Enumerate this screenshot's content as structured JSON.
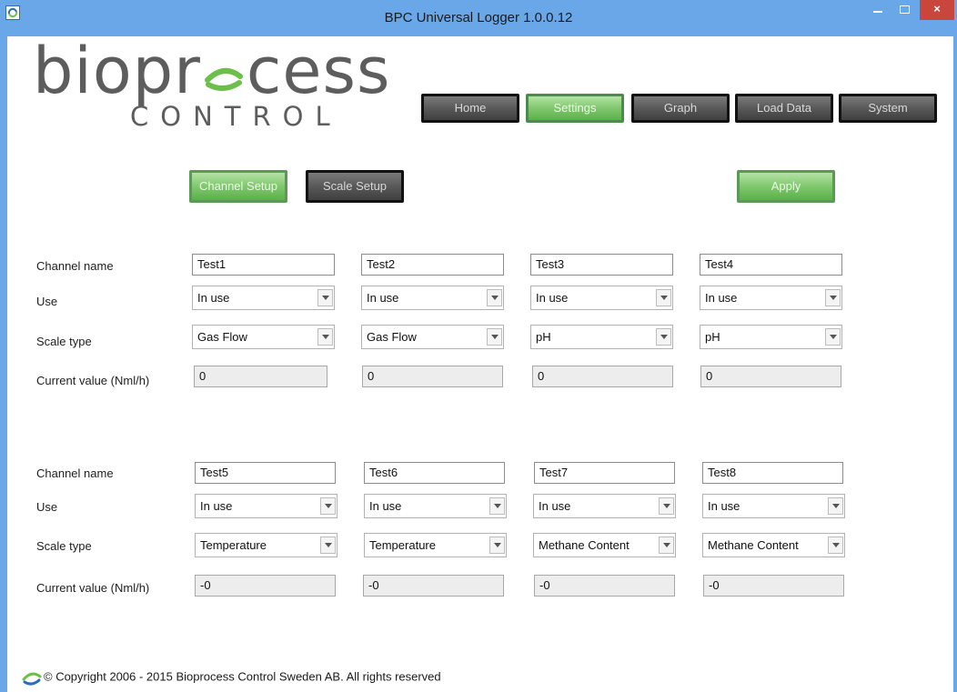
{
  "window": {
    "title": "BPC Universal Logger 1.0.0.12",
    "close_glyph": "×"
  },
  "logo": {
    "main": "bioprocess",
    "main_before": "biopr",
    "main_after": "cess",
    "sub": "CONTROL"
  },
  "nav": {
    "home": "Home",
    "settings": "Settings",
    "graph": "Graph",
    "load_data": "Load Data",
    "system": "System",
    "active": "Settings"
  },
  "subnav": {
    "channel_setup": "Channel Setup",
    "scale_setup": "Scale Setup",
    "apply": "Apply",
    "active": "Channel Setup"
  },
  "labels": {
    "channel_name": "Channel name",
    "use": "Use",
    "scale_type": "Scale type",
    "current_value": "Current value (Nml/h)"
  },
  "groups": [
    {
      "channels": [
        {
          "name": "Test1",
          "use": "In use",
          "scale_type": "Gas Flow",
          "current_value": "0"
        },
        {
          "name": "Test2",
          "use": "In use",
          "scale_type": "Gas Flow",
          "current_value": "0"
        },
        {
          "name": "Test3",
          "use": "In use",
          "scale_type": "pH",
          "current_value": "0"
        },
        {
          "name": "Test4",
          "use": "In use",
          "scale_type": "pH",
          "current_value": "0"
        }
      ]
    },
    {
      "channels": [
        {
          "name": "Test5",
          "use": "In use",
          "scale_type": "Temperature",
          "current_value": "-0"
        },
        {
          "name": "Test6",
          "use": "In use",
          "scale_type": "Temperature",
          "current_value": "-0"
        },
        {
          "name": "Test7",
          "use": "In use",
          "scale_type": "Methane Content",
          "current_value": "-0"
        },
        {
          "name": "Test8",
          "use": "In use",
          "scale_type": "Methane Content",
          "current_value": "-0"
        }
      ]
    }
  ],
  "footer": {
    "copyright": "© Copyright 2006 - 2015 Bioprocess Control Sweden AB. All rights reserved"
  },
  "colors": {
    "titlebar": "#6aa7e8",
    "nav_dark": "#595959",
    "nav_active_green": "#7fc86d",
    "close_red": "#c9463d",
    "logo_gray": "#5d5d5d",
    "logo_green": "#6cc04a"
  },
  "icons": {
    "app": "bioprocess-logo-icon",
    "minimize": "minimize-icon",
    "maximize": "maximize-icon",
    "close": "close-icon",
    "dropdown": "chevron-down-icon",
    "footer_logo": "bioprocess-logo-icon"
  }
}
